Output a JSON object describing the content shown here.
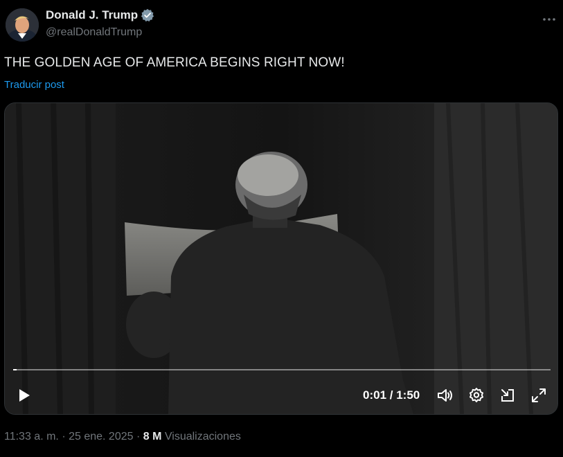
{
  "author": {
    "display_name": "Donald J. Trump",
    "handle": "@realDonaldTrump",
    "verified": true
  },
  "post": {
    "text": "THE GOLDEN AGE OF AMERICA BEGINS RIGHT NOW!",
    "translate_label": "Traducir post"
  },
  "video": {
    "current_time": "0:01",
    "separator": " / ",
    "duration": "1:50",
    "progress_fraction": 0.006
  },
  "meta": {
    "timestamp": "11:33 a. m.",
    "dot": "·",
    "date": "25 ene. 2025",
    "views_count": "8 M",
    "views_label": "Visualizaciones"
  },
  "colors": {
    "accent": "#1d9bf0",
    "text": "#e7e9ea",
    "muted": "#71767b",
    "background": "#000000"
  },
  "icons": [
    "verified-badge-icon",
    "more-icon",
    "play-icon",
    "volume-icon",
    "settings-icon",
    "pip-icon",
    "fullscreen-icon"
  ]
}
